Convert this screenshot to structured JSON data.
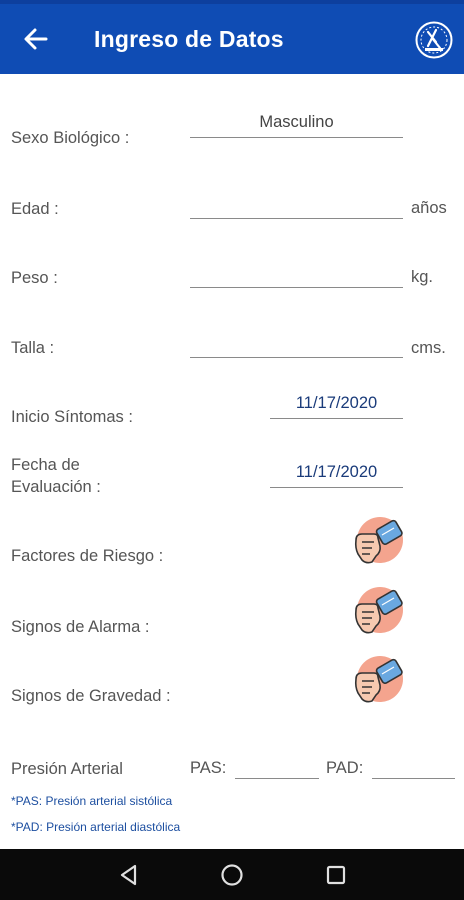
{
  "appbar": {
    "title": "Ingreso de Datos"
  },
  "form": {
    "sexo": {
      "label": "Sexo Biológico :",
      "value": "Masculino"
    },
    "edad": {
      "label": "Edad :",
      "value": "",
      "unit": "años"
    },
    "peso": {
      "label": "Peso :",
      "value": "",
      "unit": "kg."
    },
    "talla": {
      "label": "Talla :",
      "value": "",
      "unit": "cms."
    },
    "inicio": {
      "label": "Inicio Síntomas :",
      "value": "11/17/2020"
    },
    "fecha": {
      "label_line1": "Fecha de",
      "label_line2": "Evaluación :",
      "value": "11/17/2020"
    },
    "factores": {
      "label": "Factores de Riesgo :"
    },
    "alarma": {
      "label": "Signos de Alarma :"
    },
    "gravedad": {
      "label": "Signos de Gravedad :"
    },
    "presion": {
      "label": "Presión Arterial",
      "pas_label": "PAS:",
      "pad_label": "PAD:",
      "pas_value": "",
      "pad_value": ""
    }
  },
  "notes": {
    "pas": "*PAS: Presión arterial sistólica",
    "pad": "*PAD: Presión arterial diastólica"
  },
  "icons": {
    "back": "arrow-left-icon",
    "logo": "institution-logo",
    "selector": "hand-tap-icon",
    "nav_back": "triangle-back-icon",
    "nav_home": "circle-home-icon",
    "nav_recents": "square-recents-icon"
  },
  "colors": {
    "appbar": "#0f4cb4",
    "date_text": "#1a3b7a",
    "note_text": "#1d4fa0",
    "navbar": "#0a0a0a"
  }
}
